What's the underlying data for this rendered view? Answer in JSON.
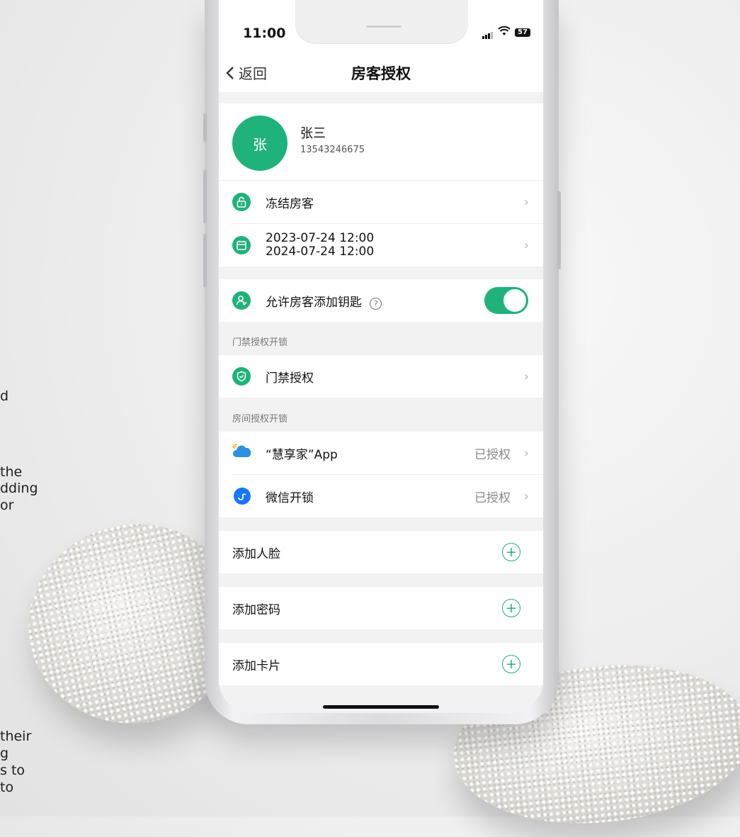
{
  "side_text": [
    "d",
    "the",
    "dding",
    "or",
    "their",
    "g",
    "s to",
    "to"
  ],
  "status_bar": {
    "time": "11:00",
    "battery": "57"
  },
  "nav": {
    "back_label": "返回",
    "title": "房客授权"
  },
  "guest": {
    "avatar_char": "张",
    "name": "张三",
    "phone": "13543246675"
  },
  "rows": {
    "freeze": {
      "label": "冻结房客"
    },
    "dates": {
      "start": "2023-07-24 12:00",
      "end": "2024-07-24 12:00"
    },
    "allow_keys": {
      "label": "允许房客添加钥匙",
      "enabled": true
    }
  },
  "access_section": {
    "header": "门禁授权开锁",
    "item_label": "门禁授权"
  },
  "room_section": {
    "header": "房间授权开锁",
    "items": [
      {
        "label": "“慧享家”App",
        "status": "已授权"
      },
      {
        "label": "微信开锁",
        "status": "已授权"
      }
    ]
  },
  "add_items": {
    "face": "添加人脸",
    "password": "添加密码",
    "card": "添加卡片"
  },
  "colors": {
    "accent": "#1fb27a",
    "wechat_blue": "#1677ff"
  }
}
